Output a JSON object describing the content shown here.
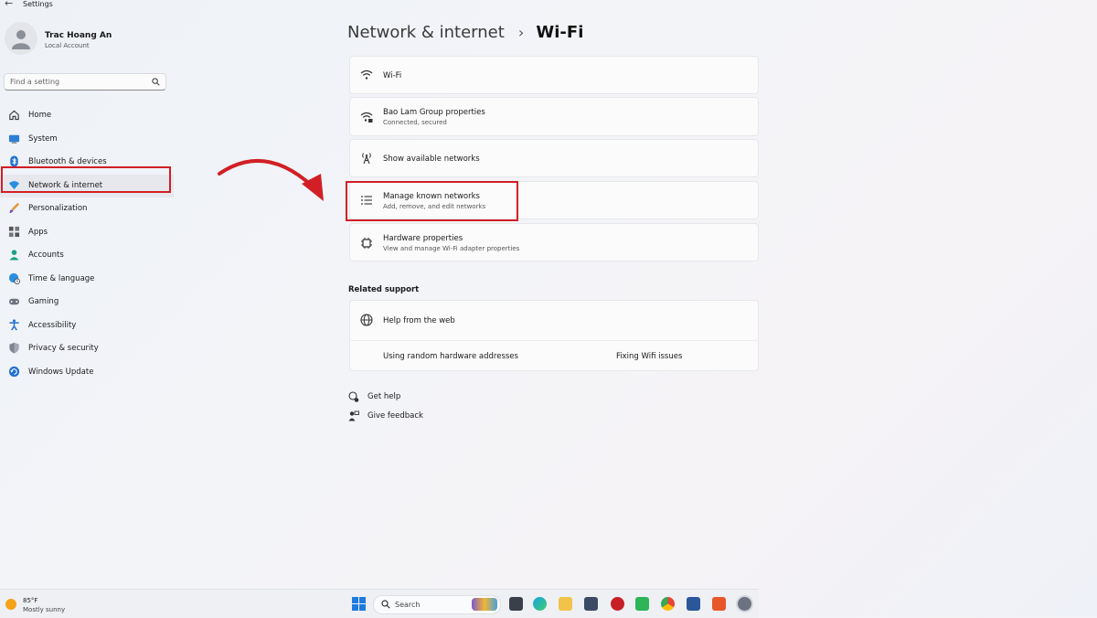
{
  "window": {
    "title": "Settings",
    "back_glyph": "←"
  },
  "profile": {
    "name": "Trac Hoang An",
    "account": "Local Account"
  },
  "search": {
    "placeholder": "Find a setting"
  },
  "nav": {
    "items": [
      {
        "label": "Home",
        "icon": "home-icon"
      },
      {
        "label": "System",
        "icon": "system-icon"
      },
      {
        "label": "Bluetooth & devices",
        "icon": "bluetooth-icon"
      },
      {
        "label": "Network & internet",
        "icon": "wifi-icon",
        "active": true
      },
      {
        "label": "Personalization",
        "icon": "brush-icon"
      },
      {
        "label": "Apps",
        "icon": "apps-icon"
      },
      {
        "label": "Accounts",
        "icon": "accounts-icon"
      },
      {
        "label": "Time & language",
        "icon": "globe-clock-icon"
      },
      {
        "label": "Gaming",
        "icon": "gamepad-icon"
      },
      {
        "label": "Accessibility",
        "icon": "accessibility-icon"
      },
      {
        "label": "Privacy & security",
        "icon": "shield-icon"
      },
      {
        "label": "Windows Update",
        "icon": "update-icon"
      }
    ]
  },
  "breadcrumb": {
    "parent": "Network & internet",
    "separator": "›",
    "current": "Wi-Fi"
  },
  "cards": [
    {
      "title": "Wi-Fi",
      "subtitle": "",
      "icon": "wifi-icon"
    },
    {
      "title": "Bao Lam Group properties",
      "subtitle": "Connected, secured",
      "icon": "wifi-secured-icon"
    },
    {
      "title": "Show available networks",
      "subtitle": "",
      "icon": "antenna-icon"
    },
    {
      "title": "Manage known networks",
      "subtitle": "Add, remove, and edit networks",
      "icon": "list-icon"
    },
    {
      "title": "Hardware properties",
      "subtitle": "View and manage Wi-Fi adapter properties",
      "icon": "chip-icon"
    }
  ],
  "related_support": {
    "heading": "Related support",
    "help_from_web": "Help from the web",
    "links": [
      "Using random hardware addresses",
      "Fixing Wifi issues"
    ]
  },
  "help_links": {
    "get_help": "Get help",
    "give_feedback": "Give feedback"
  },
  "taskbar": {
    "weather_temp": "85°F",
    "weather_condition": "Mostly sunny",
    "search_label": "Search"
  },
  "colors": {
    "highlight": "#d11f25",
    "accent": "#0067c0"
  }
}
